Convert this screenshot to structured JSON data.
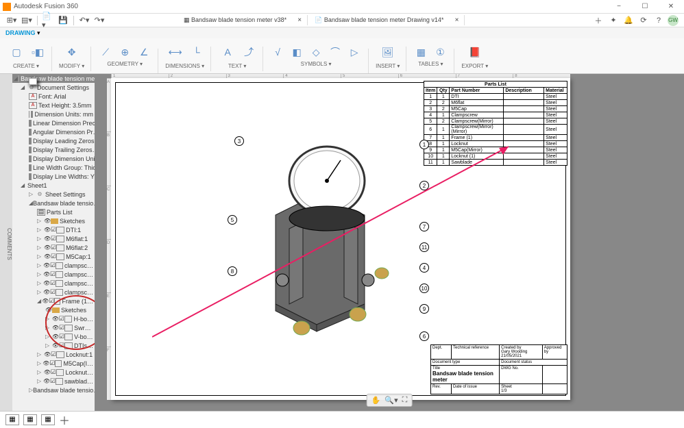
{
  "app": {
    "title": "Autodesk Fusion 360"
  },
  "qat": {
    "tab1": "Bandsaw blade tension meter v38*",
    "tab2": "Bandsaw blade tension meter Drawing v14*",
    "userInitials": "GW"
  },
  "ribbon": {
    "mode": "DRAWING",
    "groups": {
      "create": "CREATE ▾",
      "modify": "MODIFY ▾",
      "geometry": "GEOMETRY ▾",
      "dimensions": "DIMENSIONS ▾",
      "text": "TEXT ▾",
      "symbols": "SYMBOLS ▾",
      "insert": "INSERT ▾",
      "tables": "TABLES ▾",
      "export": "EXPORT ▾"
    }
  },
  "browser": {
    "root": "Bandsaw blade tension meter…",
    "docSettings": "Document Settings",
    "settings": [
      "Font: Arial",
      "Text Height: 3.5mm",
      "Dimension Units: mm",
      "Linear Dimension Prec…",
      "Angular Dimension Pr…",
      "Display Leading Zeros…",
      "Display Trailing Zeros…",
      "Display Dimension Unit…",
      "Line Width Group: Thick",
      "Display Line Widths: Y…"
    ],
    "sheet": "Sheet1",
    "sheetSettings": "Sheet Settings",
    "bstView": "Bandsaw blade tensio…",
    "partsList": "Parts List",
    "sketches": "Sketches",
    "comps": [
      "DTI:1",
      "M6flat:1",
      "M6flat:2",
      "M5Cap:1",
      "clampsc…",
      "clampsc…",
      "clampsc…",
      "clampsc…"
    ],
    "frame": "Frame (1…",
    "frameSub": [
      "Sketches",
      "H-bo…",
      "Swr…",
      "V-bo…",
      "DTIs…"
    ],
    "tail": [
      "Locknut:1",
      "M5Cap(I…",
      "Locknut…",
      "sawblad…",
      "Bandsaw blade tensio…"
    ]
  },
  "parts": {
    "title": "Parts List",
    "headers": [
      "Item",
      "Qty",
      "Part Number",
      "Description",
      "Material"
    ],
    "rows": [
      [
        "1",
        "1",
        "DTI",
        "",
        "Steel"
      ],
      [
        "2",
        "2",
        "M6flat",
        "",
        "Steel"
      ],
      [
        "3",
        "2",
        "M5Cap",
        "",
        "Steel"
      ],
      [
        "4",
        "1",
        "Clampscrew",
        "",
        "Steel"
      ],
      [
        "5",
        "2",
        "Clampscrew(Mirror)",
        "",
        "Steel"
      ],
      [
        "6",
        "1",
        "Clampscrew(Mirror)(Mirror)",
        "",
        "Steel"
      ],
      [
        "7",
        "1",
        "Frame (1)",
        "",
        "Steel"
      ],
      [
        "8",
        "1",
        "Locknut",
        "",
        "Steel"
      ],
      [
        "9",
        "1",
        "M5Cap(Mirror)",
        "",
        "Steel"
      ],
      [
        "10",
        "1",
        "Locknut (1)",
        "",
        "Steel"
      ],
      [
        "11",
        "1",
        "Sawblade",
        "",
        "Steel"
      ]
    ]
  },
  "titleblock": {
    "dept": "Dept.",
    "techref": "Technical reference",
    "createdby": "Created by",
    "creator": "Gary Wooding",
    "date": "21/05/2021",
    "approvedby": "Approved by",
    "doctype": "Document type",
    "docstatus": "Document status",
    "title": "Title",
    "dwgtitle": "Bandsaw blade tension meter",
    "dwgno": "DWG No.",
    "rev": "Rev.",
    "dateissue": "Date of issue",
    "sheet": "Sheet",
    "sheetval": "1/3"
  },
  "balloons": [
    "1",
    "2",
    "3",
    "4",
    "5",
    "6",
    "7",
    "8",
    "9",
    "10",
    "11"
  ],
  "leftStrip": "COMMENTS"
}
